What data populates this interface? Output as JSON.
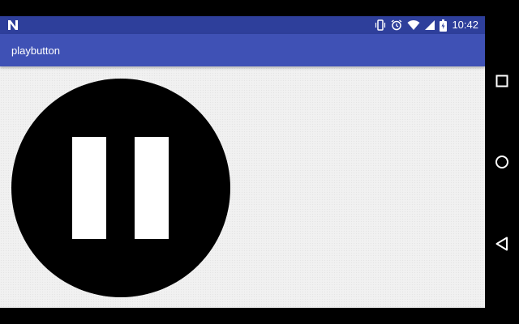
{
  "status_bar": {
    "time": "10:42",
    "icons": [
      "n-notification-icon",
      "vibrate-icon",
      "alarm-icon",
      "wifi-icon",
      "signal-icon",
      "battery-icon"
    ]
  },
  "app_bar": {
    "title": "playbutton"
  },
  "main": {
    "play_button": {
      "state": "pause",
      "icon": "pause-icon"
    }
  },
  "nav_bar": {
    "buttons": [
      "recents-icon",
      "home-icon",
      "back-icon"
    ]
  },
  "colors": {
    "status_bar": "#2e3f9b",
    "app_bar": "#3f51b5",
    "background": "#f1f1f1",
    "button": "#000000",
    "pause_bars": "#ffffff"
  }
}
